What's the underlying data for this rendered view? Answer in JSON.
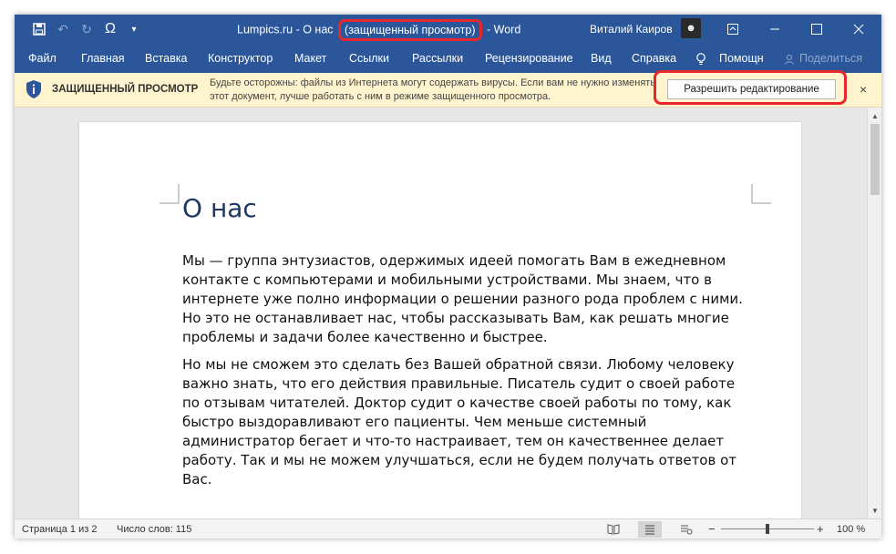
{
  "titlebar": {
    "doc_name": "Lumpics.ru - О нас",
    "mode": "(защищенный просмотр)",
    "app": "-  Word",
    "user": "Виталий Каиров",
    "qat": {
      "save": "save-icon",
      "undo": "undo-icon",
      "redo": "redo-icon",
      "symbol": "Ω",
      "customize": "customize-qat-icon"
    }
  },
  "ribbon": {
    "tabs": [
      "Файл",
      "Главная",
      "Вставка",
      "Конструктор",
      "Макет",
      "Ссылки",
      "Рассылки",
      "Рецензирование",
      "Вид",
      "Справка"
    ],
    "help": "Помощн",
    "share": "Поделиться"
  },
  "protected_view": {
    "title": "ЗАЩИЩЕННЫЙ ПРОСМОТР",
    "message": "Будьте осторожны: файлы из Интернета могут содержать вирусы. Если вам не нужно изменять этот документ, лучше работать с ним в режиме защищенного просмотра.",
    "enable_button": "Разрешить редактирование",
    "close": "×"
  },
  "document": {
    "heading": "О нас",
    "paragraphs": [
      "Мы — группа энтузиастов, одержимых идеей помогать Вам в ежедневном контакте с компьютерами и мобильными устройствами. Мы знаем, что в интернете уже полно информации о решении разного рода проблем с ними. Но это не останавливает нас, чтобы рассказывать Вам, как решать многие проблемы и задачи более качественно и быстрее.",
      "Но мы не сможем это сделать без Вашей обратной связи. Любому человеку важно знать, что его действия правильные. Писатель судит о своей работе по отзывам читателей. Доктор судит о качестве своей работы по тому, как быстро выздоравливают его пациенты. Чем меньше системный администратор бегает и что-то настраивает, тем он качественнее делает работу. Так и мы не можем улучшаться, если не будем получать ответов от Вас."
    ]
  },
  "status": {
    "page": "Страница 1 из 2",
    "words": "Число слов: 115",
    "zoom": "100 %",
    "zoom_minus": "−",
    "zoom_plus": "+"
  },
  "colors": {
    "ribbon": "#2b579a",
    "warning_bar": "#fff4ce",
    "highlight": "#e8262b",
    "heading": "#1f3864"
  }
}
